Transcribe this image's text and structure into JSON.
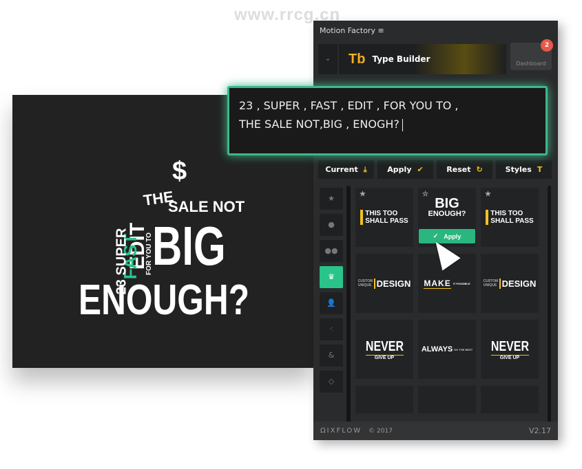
{
  "watermark": "www.rrcg.cn",
  "preview": {
    "words": [
      "$",
      "THE",
      "SALE NOT",
      "EDIT",
      "FAST",
      "23 SUPER",
      "FOR YOU TO",
      "BIG",
      "ENOUGH?"
    ]
  },
  "panel": {
    "title": "Motion Factory ≡",
    "module": {
      "logo": "Tb",
      "name": "Type Builder"
    },
    "dashboard": {
      "label": "Dashboard",
      "badge": "2"
    },
    "text_input": {
      "line1": "23 , SUPER , FAST , EDIT , FOR YOU TO ,",
      "line2": "THE SALE NOT,BIG , ENOGH?"
    },
    "actions": [
      {
        "label": "Current",
        "icon": "⤓"
      },
      {
        "label": "Apply",
        "icon": "✔"
      },
      {
        "label": "Reset",
        "icon": "↻"
      },
      {
        "label": "Styles",
        "icon": "T"
      }
    ],
    "categories": [
      {
        "icon": "★",
        "name": "star"
      },
      {
        "icon": "●",
        "name": "dot"
      },
      {
        "icon": "●●",
        "name": "two-dots"
      },
      {
        "icon": "♛",
        "name": "crown",
        "active": true
      },
      {
        "icon": "👤",
        "name": "person"
      },
      {
        "icon": "⁖",
        "name": "people"
      },
      {
        "icon": "&",
        "name": "ampersand"
      },
      {
        "icon": "◇",
        "name": "diamond"
      }
    ],
    "presets": [
      {
        "a": "THIS TOO",
        "b": "SHALL PASS",
        "star": true
      },
      {
        "a": "BIG",
        "b": "ENOUGH?",
        "star": true,
        "apply": "Apply"
      },
      {
        "a": "THIS TOO",
        "b": "SHALL PASS",
        "star": true
      },
      {
        "a": "CUSTOM UNIQUE",
        "b": "DESIGN"
      },
      {
        "a": "MAKE",
        "b": "IT POSSIBLE"
      },
      {
        "a": "CUSTOM UNIQUE",
        "b": "DESIGN"
      },
      {
        "a": "NEVER",
        "b": "GIVE UP"
      },
      {
        "a": "ALWAYS",
        "b": "DO THE BEST"
      },
      {
        "a": "NEVER",
        "b": "GIVE UP"
      }
    ],
    "footer": {
      "brand": "ΩIXFLOW",
      "copyright": "© 2017",
      "version": "V2.17"
    }
  },
  "colors": {
    "accent": "#29c489",
    "yellow": "#f2c21e",
    "glow": "#3fb78b"
  }
}
